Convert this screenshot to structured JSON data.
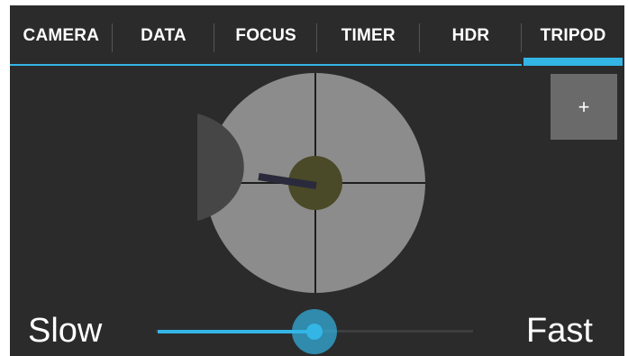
{
  "tabs": [
    {
      "label": "CAMERA",
      "active": false
    },
    {
      "label": "DATA",
      "active": false
    },
    {
      "label": "FOCUS",
      "active": false
    },
    {
      "label": "TIMER",
      "active": false
    },
    {
      "label": "HDR",
      "active": false
    },
    {
      "label": "TRIPOD",
      "active": true
    }
  ],
  "add_button": {
    "label": "+"
  },
  "speed": {
    "min_label": "Slow",
    "max_label": "Fast",
    "value": 0.5
  },
  "colors": {
    "accent": "#33b5e5",
    "background": "#2b2b2b",
    "wheel": "#8c8c8c",
    "hub": "#4a4a28"
  }
}
